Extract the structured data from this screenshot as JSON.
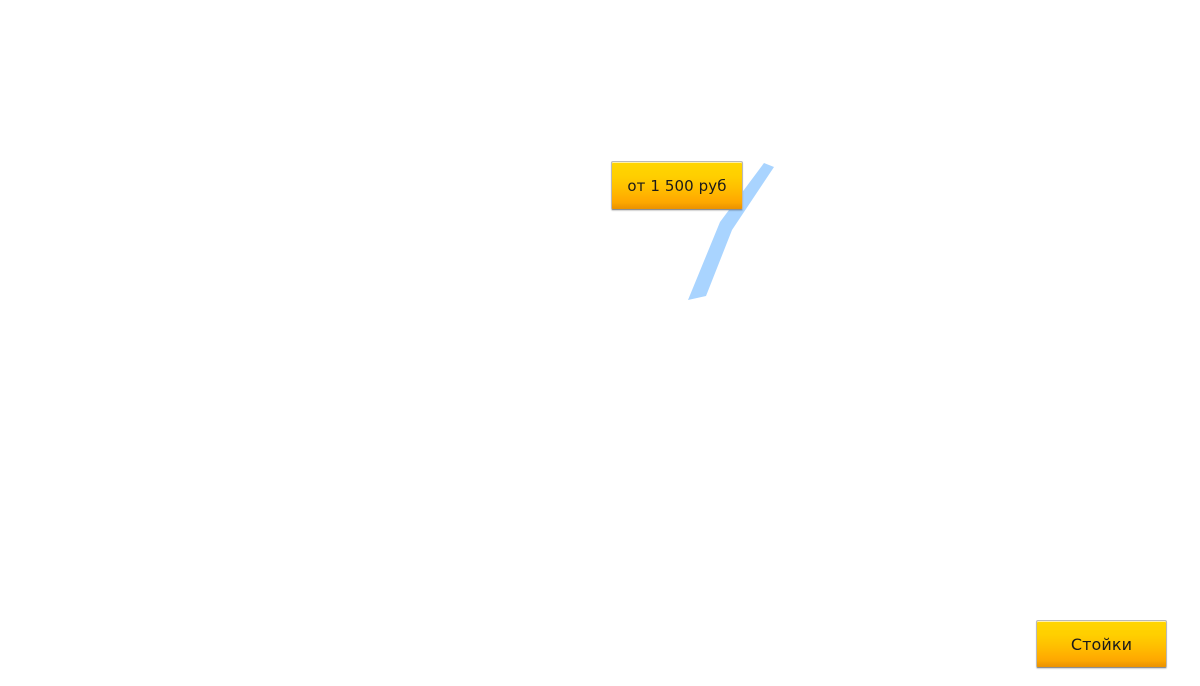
{
  "buttons": {
    "price_label": "от 1 500 руб",
    "category_label": "Стойки"
  },
  "colors": {
    "button_gradient_top": "#ffd600",
    "button_gradient_bottom": "#f49f00",
    "pointer_line": "#a9d4ff",
    "background": "#ffffff"
  },
  "icons": {
    "pointer_line": "diagonal-callout-line"
  }
}
